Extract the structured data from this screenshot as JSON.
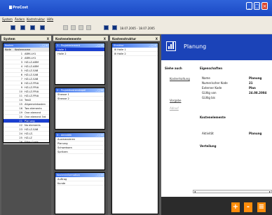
{
  "app": {
    "title": "ProCost"
  },
  "menu": [
    "System",
    "Ändern",
    "Kostrstruktur",
    "Hilfe"
  ],
  "toolbar": {
    "date_range": "18.07.2005 - 18.07.2005"
  },
  "panels": {
    "system": {
      "title": "System",
      "close": "X"
    },
    "kostenelemente": {
      "title": "Kostenelemente",
      "close": "X"
    },
    "kostenstruktur": {
      "title": "Kostenstruktur",
      "close": "X"
    }
  },
  "kosten_list": {
    "header": "Kosten",
    "controls": "_ □ ×",
    "col_code": "Kode",
    "col_name": "Kostenname",
    "rows": [
      {
        "n": "1",
        "l": "ABM-LH1"
      },
      {
        "n": "2",
        "l": "ABM-LH1"
      },
      {
        "n": "3",
        "l": "HZ-LZ-ABM"
      },
      {
        "n": "4",
        "l": "HZ-LZ-ABM"
      },
      {
        "n": "5",
        "l": "HZ-LZ-SAB"
      },
      {
        "n": "6",
        "l": "HZ-LZ-SAB"
      },
      {
        "n": "7",
        "l": "HZ-LZ-SAB"
      },
      {
        "n": "8",
        "l": "HZ-LZ-FRIA"
      },
      {
        "n": "9",
        "l": "HZ-LZ-FRIA"
      },
      {
        "n": "10",
        "l": "HZ-LZ-FRIA"
      },
      {
        "n": "11",
        "l": "HZ-LZ-FRIA"
      },
      {
        "n": "14",
        "l": "Test2"
      },
      {
        "n": "15",
        "l": "Allgemeinkosten"
      },
      {
        "n": "16",
        "l": "Two elements"
      },
      {
        "n": "19",
        "l": "One element"
      },
      {
        "n": "20",
        "l": "One element 3rd level"
      },
      {
        "n": "21",
        "l": "Planung"
      },
      {
        "n": "22",
        "l": "No elements"
      },
      {
        "n": "23",
        "l": "HZ-LZ-SAB"
      },
      {
        "n": "24",
        "l": "HZ-LZ-"
      },
      {
        "n": "25",
        "l": "HZ-LZ"
      },
      {
        "n": "26",
        "l": "Filter Costs"
      }
    ]
  },
  "projektelement": {
    "header": "1 - Projektelement",
    "controls": "_ □ ×",
    "rows": [
      "Halle 1",
      "Halle 2"
    ]
  },
  "projektkosten": {
    "header": "2 - Projektkostenstapel",
    "controls": "_ □ ×",
    "rows": [
      "Strasse 1",
      "Strasse 2"
    ]
  },
  "aktivitaet": {
    "header": "3 - Aktivität",
    "controls": "_ □ ×",
    "rows": [
      "Ausmassieren",
      "Planung",
      "Schweissen",
      "Spritzen"
    ]
  },
  "kosteninfo": {
    "header": "Kosteninformation",
    "controls": "_ □ ×",
    "rows": [
      "Auftrag",
      "Kunde"
    ]
  },
  "struktur": {
    "header": "Struktur",
    "controls": "_ □ ×",
    "items": [
      "Halle 1",
      "Halle 2"
    ]
  },
  "detail": {
    "title": "Planung",
    "siehe_auch": "Siehe auch",
    "links": [
      "Kostenhaltung",
      "Vorgabe",
      "Ablauf"
    ],
    "eigenschaften": "Eigenschaften",
    "props": [
      {
        "k": "Name",
        "v": "Planung"
      },
      {
        "k": "Numerischer Kode",
        "v": "21"
      },
      {
        "k": "Externer Kode",
        "v": "Plan"
      },
      {
        "k": "Gültig von",
        "v": "24.08.2004"
      },
      {
        "k": "Gültig bis",
        "v": ""
      }
    ],
    "kostenelemente": "Kostenelemente",
    "aktivitaet_label": "Aktivität",
    "aktivitaet_value": "Planung",
    "verteilung": "Verteilung",
    "buttons": [
      "+",
      "-",
      "≡"
    ]
  }
}
